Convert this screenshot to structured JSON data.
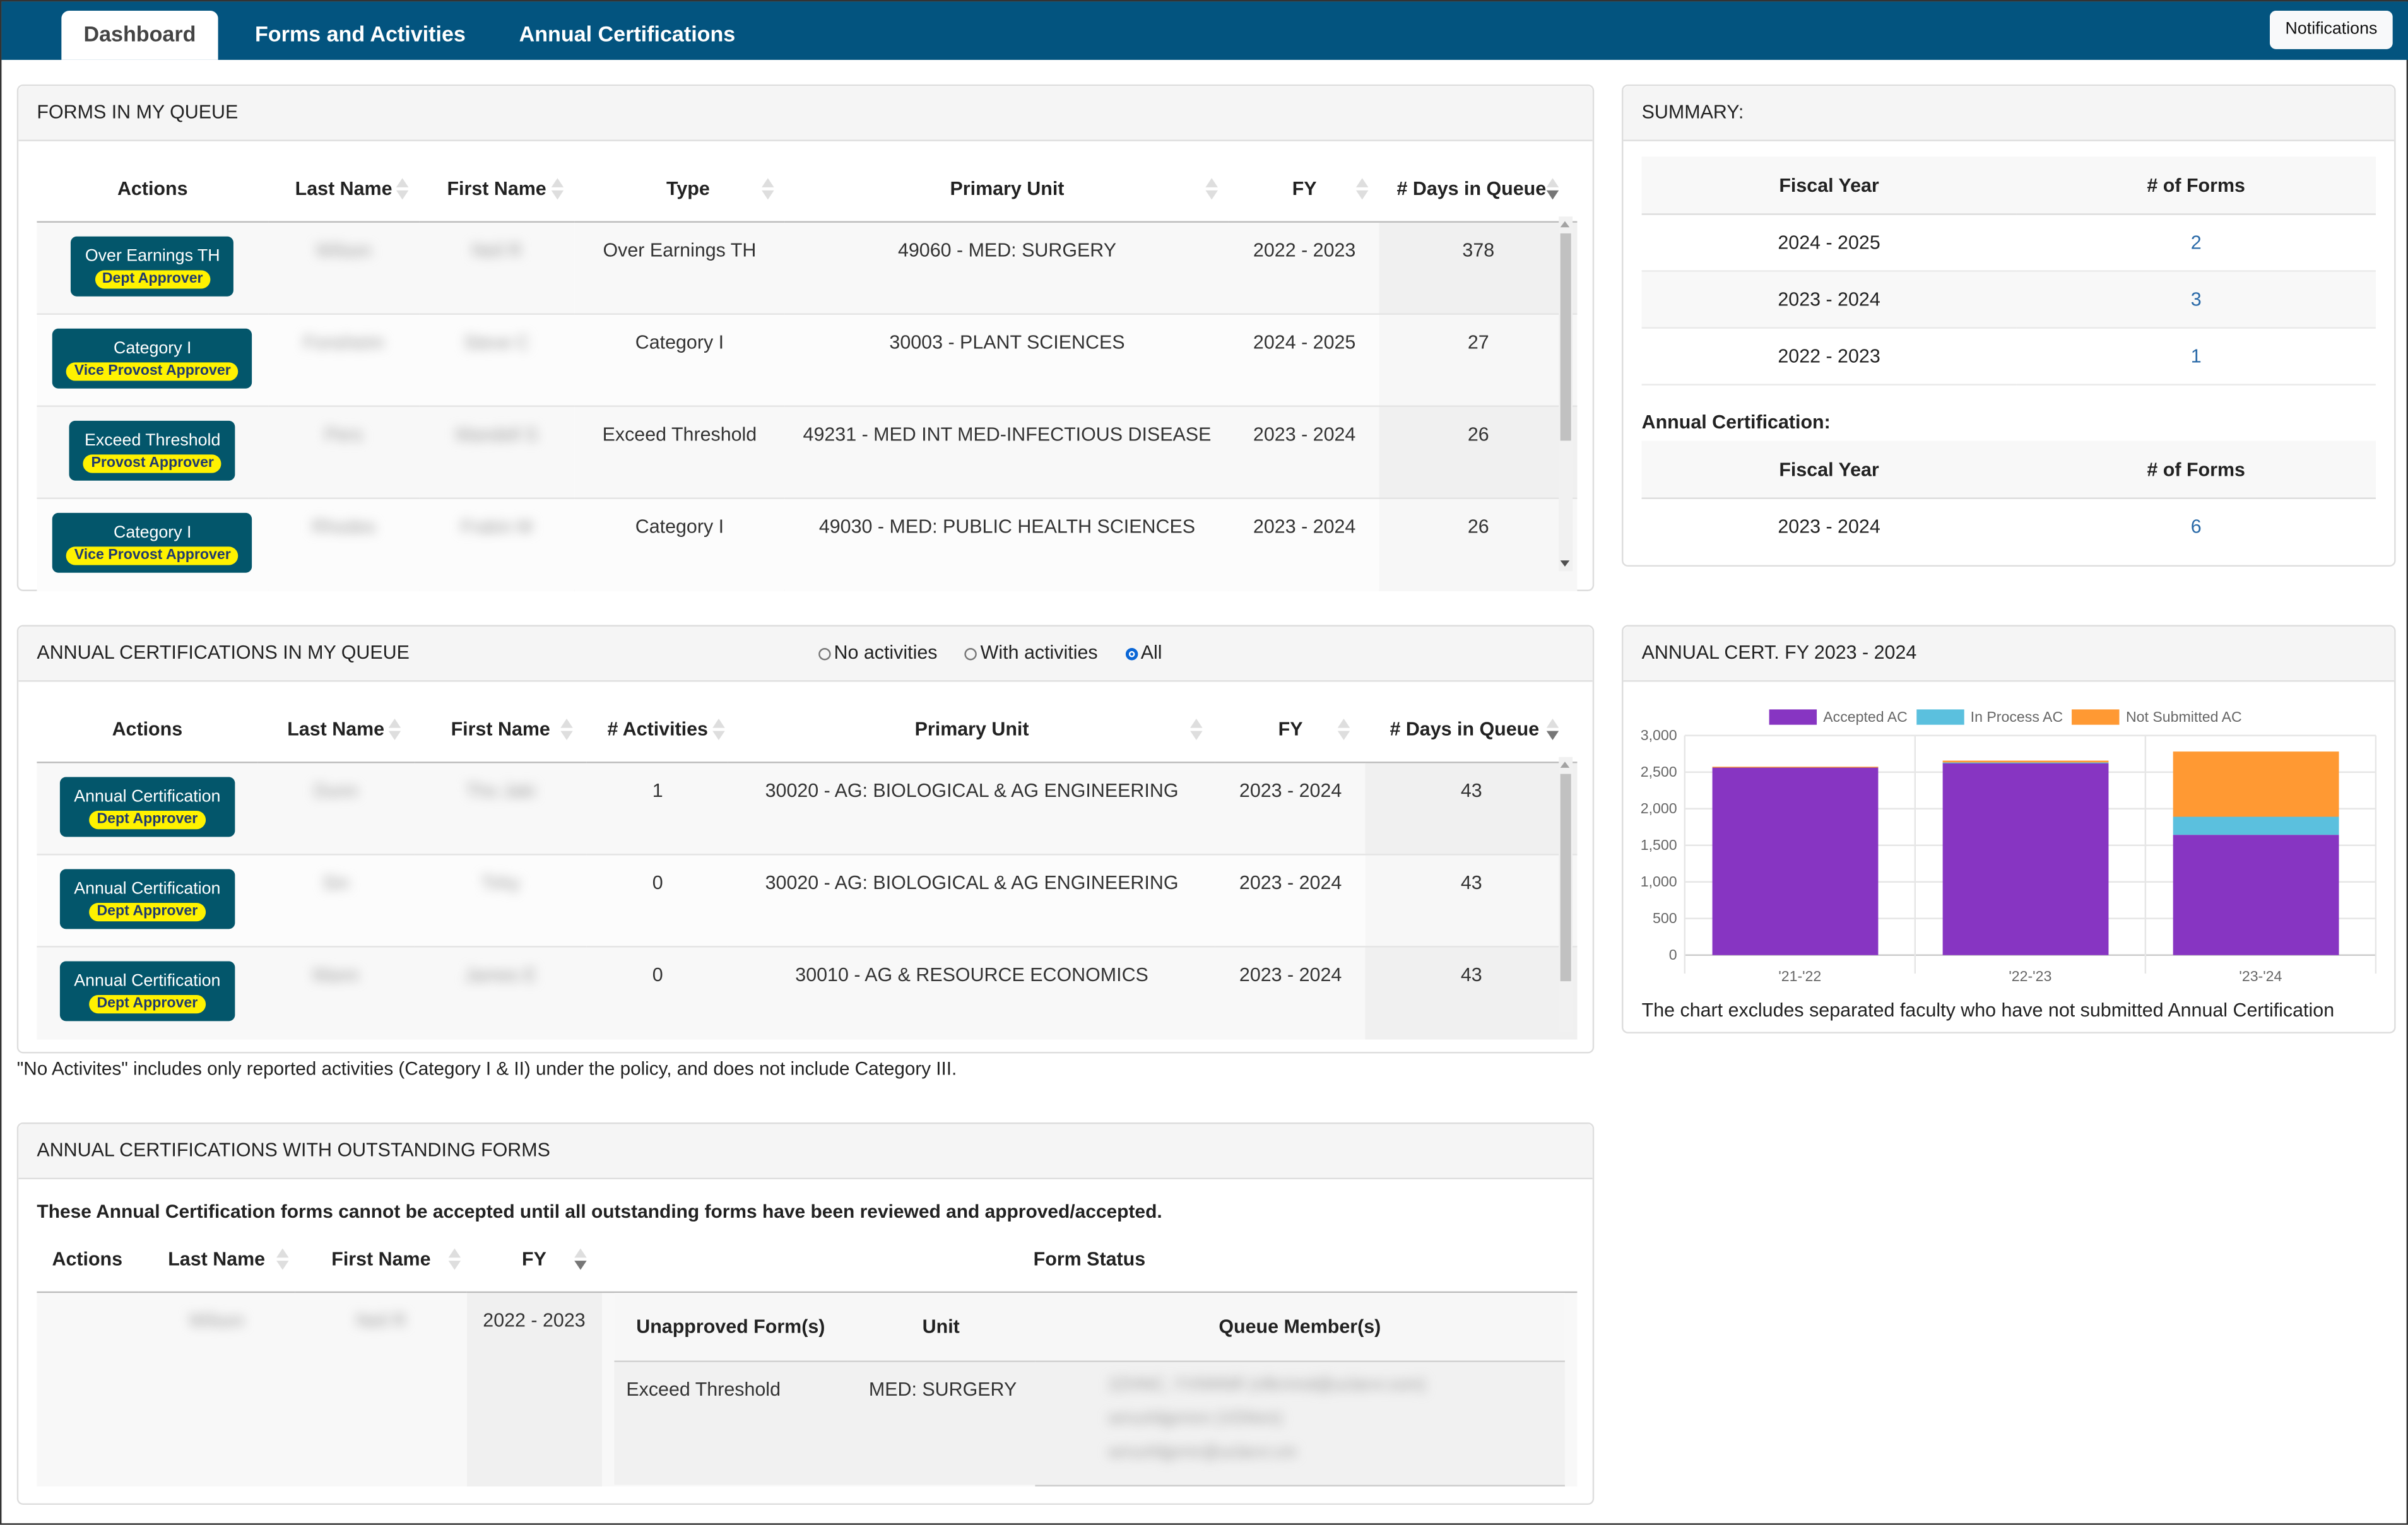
{
  "nav": {
    "tabs": [
      {
        "label": "Dashboard",
        "active": true
      },
      {
        "label": "Forms and Activities",
        "active": false
      },
      {
        "label": "Annual Certifications",
        "active": false
      }
    ],
    "notifications_label": "Notifications",
    "color": "#03547f"
  },
  "forms_queue": {
    "title": "FORMS IN MY QUEUE",
    "columns": [
      "Actions",
      "Last Name",
      "First Name",
      "Type",
      "Primary Unit",
      "FY",
      "# Days in Queue"
    ],
    "sorted_column": "# Days in Queue",
    "rows": [
      {
        "action": "Over Earnings TH",
        "role": "Dept Approver",
        "last_name": "Wilson",
        "first_name": "Neil R",
        "type": "Over Earnings TH",
        "primary_unit": "49060 - MED: SURGERY",
        "fy": "2022 - 2023",
        "days": "378"
      },
      {
        "action": "Category I",
        "role": "Vice Provost Approver",
        "last_name": "Fonsheim",
        "first_name": "Steve C",
        "type": "Category I",
        "primary_unit": "30003 - PLANT SCIENCES",
        "fy": "2024 - 2025",
        "days": "27"
      },
      {
        "action": "Exceed Threshold",
        "role": "Provost Approver",
        "last_name": "Pers",
        "first_name": "Mandell S",
        "type": "Exceed Threshold",
        "primary_unit": "49231 - MED INT MED-INFECTIOUS DISEASE",
        "fy": "2023 - 2024",
        "days": "26"
      },
      {
        "action": "Category I",
        "role": "Vice Provost Approver",
        "last_name": "Rhodes",
        "first_name": "Frakin M",
        "type": "Category I",
        "primary_unit": "49030 - MED: PUBLIC HEALTH SCIENCES",
        "fy": "2023 - 2024",
        "days": "26"
      }
    ]
  },
  "summary": {
    "title": "SUMMARY:",
    "columns": [
      "Fiscal Year",
      "# of Forms"
    ],
    "rows": [
      {
        "fy": "2024 - 2025",
        "count": "2"
      },
      {
        "fy": "2023 - 2024",
        "count": "3"
      },
      {
        "fy": "2022 - 2023",
        "count": "1"
      }
    ],
    "annual_cert_label": "Annual Certification:",
    "annual_cert_rows": [
      {
        "fy": "2023 - 2024",
        "count": "6"
      }
    ]
  },
  "ac_queue": {
    "title": "ANNUAL CERTIFICATIONS IN MY QUEUE",
    "filters": [
      {
        "label": "No activities",
        "checked": false
      },
      {
        "label": "With activities",
        "checked": false
      },
      {
        "label": "All",
        "checked": true
      }
    ],
    "columns": [
      "Actions",
      "Last Name",
      "First Name",
      "# Activities",
      "Primary Unit",
      "FY",
      "# Days in Queue"
    ],
    "sorted_column": "# Days in Queue",
    "rows": [
      {
        "action": "Annual Certification",
        "role": "Dept Approver",
        "last_name": "Dunn",
        "first_name": "Tho Jaki",
        "activities": "1",
        "primary_unit": "30020 - AG: BIOLOGICAL & AG ENGINEERING",
        "fy": "2023 - 2024",
        "days": "43"
      },
      {
        "action": "Annual Certification",
        "role": "Dept Approver",
        "last_name": "Sin",
        "first_name": "Tirky",
        "activities": "0",
        "primary_unit": "30020 - AG: BIOLOGICAL & AG ENGINEERING",
        "fy": "2023 - 2024",
        "days": "43"
      },
      {
        "action": "Annual Certification",
        "role": "Dept Approver",
        "last_name": "Mann",
        "first_name": "James E",
        "activities": "0",
        "primary_unit": "30010 - AG & RESOURCE ECONOMICS",
        "fy": "2023 - 2024",
        "days": "43"
      }
    ],
    "footnote": "\"No Activites\" includes only reported activities (Category I & II) under the policy, and does not include Category III."
  },
  "chart_panel": {
    "title": "ANNUAL CERT. FY 2023 - 2024",
    "note": "The chart excludes separated faculty who have not submitted Annual Certification"
  },
  "chart_data": {
    "type": "bar",
    "stacked": true,
    "title": "ANNUAL CERT. FY 2023 - 2024",
    "categories": [
      "'21-'22",
      "'22-'23",
      "'23-'24"
    ],
    "series": [
      {
        "name": "Accepted AC",
        "color": "#8735c2",
        "values": [
          2563,
          2628,
          1643
        ]
      },
      {
        "name": "In Process AC",
        "color": "#5bc0de",
        "values": [
          0,
          4,
          247
        ]
      },
      {
        "name": "Not Submitted AC",
        "color": "#ff9933",
        "values": [
          11,
          25,
          891
        ]
      }
    ],
    "ylim": [
      0,
      3000
    ],
    "yticks": [
      0,
      500,
      1000,
      1500,
      2000,
      2500,
      3000
    ],
    "ytick_labels": [
      "0",
      "500",
      "1,000",
      "1,500",
      "2,000",
      "2,500",
      "3,000"
    ],
    "xlabel": "",
    "ylabel": "",
    "grid": true,
    "legend_position": "top"
  },
  "outstanding": {
    "title": "ANNUAL CERTIFICATIONS WITH OUTSTANDING FORMS",
    "notice": "These Annual Certification forms cannot be accepted until all outstanding forms have been reviewed and approved/accepted.",
    "columns": [
      "Actions",
      "Last Name",
      "First Name",
      "FY",
      "Form Status"
    ],
    "sub_columns": [
      "Unapproved Form(s)",
      "Unit",
      "Queue Member(s)"
    ],
    "rows": [
      {
        "last_name": "Wilson",
        "first_name": "Neil R",
        "fy": "2022 - 2023",
        "forms": [
          {
            "form": "Exceed Threshold",
            "unit": "MED: SURGERY",
            "members": [
              "2ZHNC, YVNNNR (nfkrmnd@uclarvr.com)",
              "wrrunhljprmrn (VDNnn)",
              "wrrunhljprmr@uclarvr.cm"
            ]
          }
        ]
      }
    ]
  }
}
